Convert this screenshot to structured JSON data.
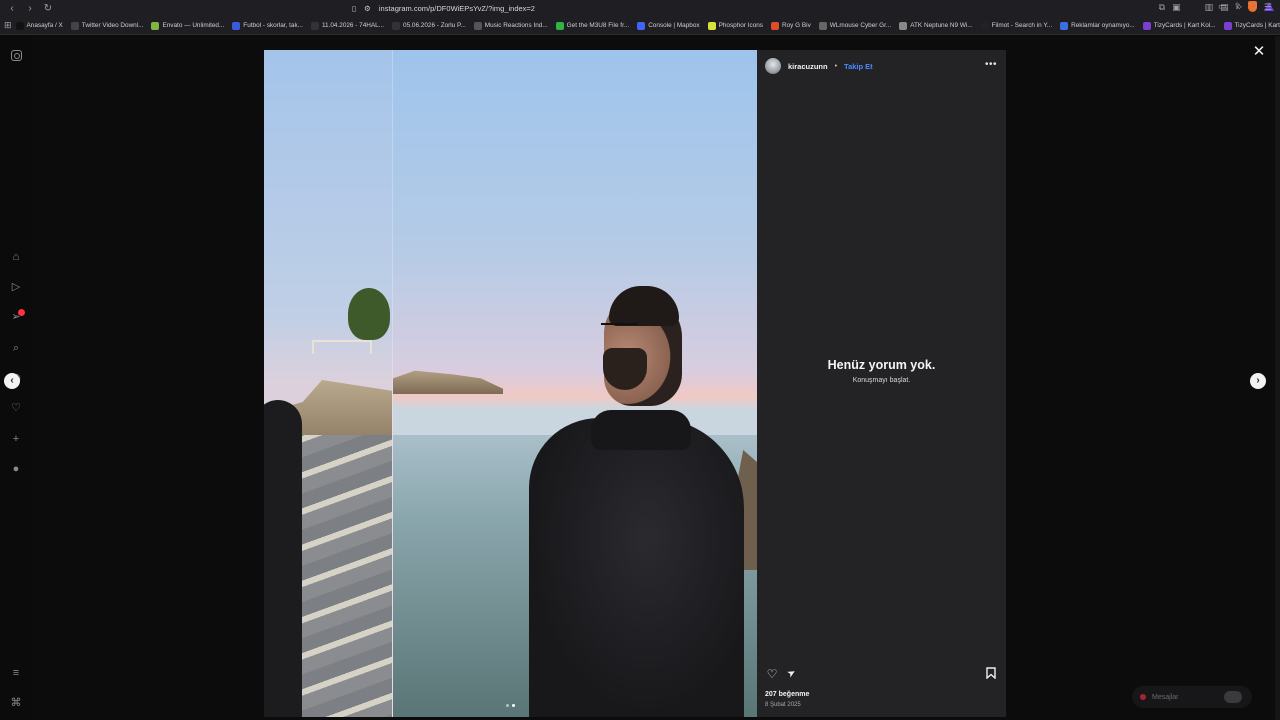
{
  "browser": {
    "url": "instagram.com/p/DF0WiEPsYvZ/?img_index=2",
    "bookmarks": [
      {
        "label": "Anasayfa / X",
        "color": "#111111"
      },
      {
        "label": "Twitter Video Downl...",
        "color": "#444444"
      },
      {
        "label": "Envato — Unlimited...",
        "color": "#82b541"
      },
      {
        "label": "Futbol - skorlar, tak...",
        "color": "#3b5bdb"
      },
      {
        "label": "11.04.2026 - 74HAL...",
        "color": "#333333"
      },
      {
        "label": "05.06.2026 - Zorlu P...",
        "color": "#333333"
      },
      {
        "label": "Music Reactions Ind...",
        "color": "#555555"
      },
      {
        "label": "Get the M3U8 File fr...",
        "color": "#2fb344"
      },
      {
        "label": "Console | Mapbox",
        "color": "#4264fb"
      },
      {
        "label": "Phosphor Icons",
        "color": "#d6e33b"
      },
      {
        "label": "Roy G Biv",
        "color": "#e04b2a"
      },
      {
        "label": "WLmouse Cyber Gr...",
        "color": "#666666"
      },
      {
        "label": "ATK Neptune N9 Wi...",
        "color": "#888888"
      },
      {
        "label": "Filmot - Search in Y...",
        "color": "#222222"
      },
      {
        "label": "Reklamlar oynamıyo...",
        "color": "#3b6ee0"
      },
      {
        "label": "TizyCards | Kart Kol...",
        "color": "#7a3fd0"
      },
      {
        "label": "TizyCards | Kart Kol...",
        "color": "#7a3fd0"
      }
    ]
  },
  "post": {
    "username": "kiracuzunn",
    "separator": "•",
    "follow_label": "Takip Et",
    "more_label": "•••",
    "empty_title": "Henüz yorum yok.",
    "empty_subtitle": "Konuşmayı başlat.",
    "likes": "207 beğenme",
    "date": "8 Şubat 2025",
    "slides_total": 2,
    "slide_active": 2
  },
  "icons": {
    "like": "♡",
    "share": "➤",
    "save": "🔖",
    "close": "✕",
    "prev": "‹",
    "next": "›"
  },
  "messages": {
    "label": "Mesajlar"
  }
}
